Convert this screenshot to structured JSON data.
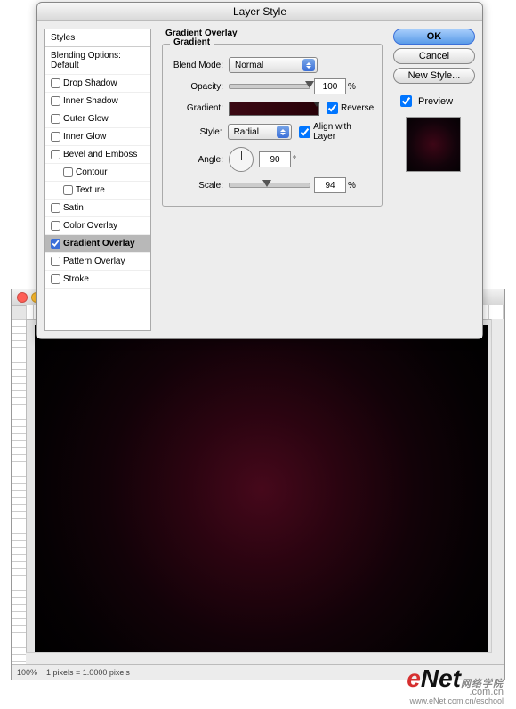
{
  "dialog": {
    "title": "Layer Style",
    "groupTitle": "Gradient Overlay",
    "innerGroupTitle": "Gradient",
    "fields": {
      "blendModeLabel": "Blend Mode:",
      "blendModeValue": "Normal",
      "opacityLabel": "Opacity:",
      "opacityValue": "100",
      "opacitySuffix": "%",
      "gradientLabel": "Gradient:",
      "reverseLabel": "Reverse",
      "styleLabel": "Style:",
      "styleValue": "Radial",
      "alignLabel": "Align with Layer",
      "angleLabel": "Angle:",
      "angleValue": "90",
      "angleSuffix": "°",
      "scaleLabel": "Scale:",
      "scaleValue": "94",
      "scaleSuffix": "%"
    }
  },
  "stylesList": {
    "header": "Styles",
    "blending": "Blending Options: Default",
    "items": [
      {
        "label": "Drop Shadow",
        "checked": false
      },
      {
        "label": "Inner Shadow",
        "checked": false
      },
      {
        "label": "Outer Glow",
        "checked": false
      },
      {
        "label": "Inner Glow",
        "checked": false
      },
      {
        "label": "Bevel and Emboss",
        "checked": false
      },
      {
        "label": "Contour",
        "checked": false,
        "sub": true
      },
      {
        "label": "Texture",
        "checked": false,
        "sub": true
      },
      {
        "label": "Satin",
        "checked": false
      },
      {
        "label": "Color Overlay",
        "checked": false
      },
      {
        "label": "Gradient Overlay",
        "checked": true,
        "selected": true
      },
      {
        "label": "Pattern Overlay",
        "checked": false
      },
      {
        "label": "Stroke",
        "checked": false
      }
    ]
  },
  "buttons": {
    "ok": "OK",
    "cancel": "Cancel",
    "newStyle": "New Style...",
    "previewLabel": "Preview"
  },
  "status": {
    "zoom": "100%",
    "info": "1 pixels = 1.0000 pixels"
  },
  "watermark": {
    "e": "e",
    "net": "Net",
    "cn": "网络学院",
    "comcn": ".com.cn",
    "url": "www.eNet.com.cn/eschool"
  }
}
